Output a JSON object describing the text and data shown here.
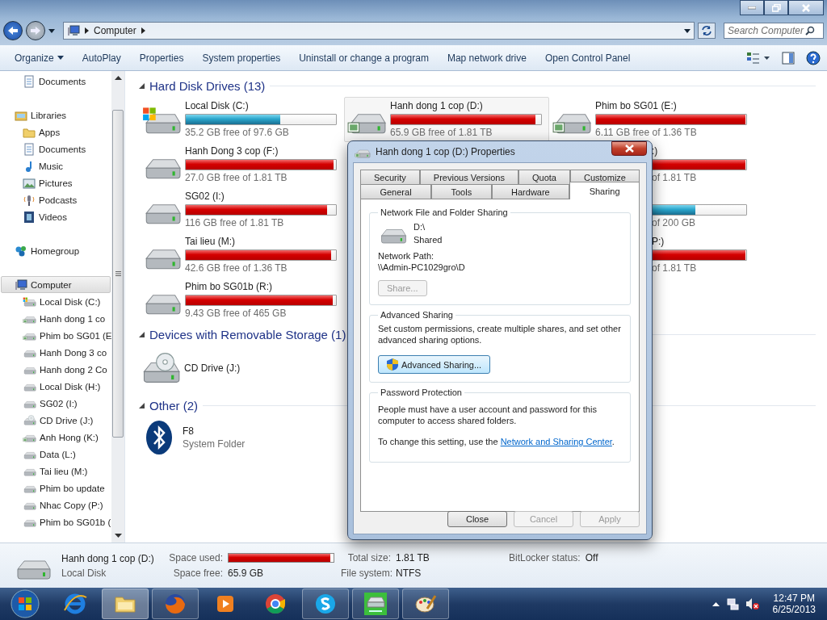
{
  "address_bar": {
    "breadcrumb": [
      "Computer"
    ],
    "search": {
      "placeholder": "Search Computer"
    }
  },
  "toolbar": {
    "items": [
      {
        "label": "Organize",
        "dropdown": true
      },
      {
        "label": "AutoPlay",
        "dropdown": false
      },
      {
        "label": "Properties",
        "dropdown": false
      },
      {
        "label": "System properties",
        "dropdown": false
      },
      {
        "label": "Uninstall or change a program",
        "dropdown": false
      },
      {
        "label": "Map network drive",
        "dropdown": false
      },
      {
        "label": "Open Control Panel",
        "dropdown": false
      }
    ]
  },
  "sidebar": {
    "scrolled_children": [
      {
        "label": "Documents",
        "kind": "document",
        "selected": false
      }
    ],
    "items": [
      {
        "label": "Libraries",
        "kind": "library",
        "selected": false,
        "children": [
          {
            "label": "Apps",
            "kind": "folder",
            "selected": false
          },
          {
            "label": "Documents",
            "kind": "document",
            "selected": false
          },
          {
            "label": "Music",
            "kind": "music",
            "selected": false
          },
          {
            "label": "Pictures",
            "kind": "pictures",
            "selected": false
          },
          {
            "label": "Podcasts",
            "kind": "podcast",
            "selected": false
          },
          {
            "label": "Videos",
            "kind": "video",
            "selected": false
          }
        ]
      },
      {
        "label": "Homegroup",
        "kind": "homegroup",
        "selected": false
      },
      {
        "label": "Computer",
        "kind": "computer",
        "selected": true,
        "children": [
          {
            "label": "Local Disk (C:)",
            "kind": "windows",
            "selected": false
          },
          {
            "label": "Hanh dong 1 co",
            "kind": "mapped",
            "selected": false
          },
          {
            "label": "Phim bo SG01 (E",
            "kind": "mapped",
            "selected": false
          },
          {
            "label": "Hanh Dong 3 co",
            "kind": "drive",
            "selected": false
          },
          {
            "label": "Hanh dong 2 Co",
            "kind": "drive",
            "selected": false
          },
          {
            "label": "Local Disk (H:)",
            "kind": "drive",
            "selected": false
          },
          {
            "label": "SG02 (I:)",
            "kind": "drive",
            "selected": false
          },
          {
            "label": "CD Drive (J:)",
            "kind": "cd",
            "selected": false
          },
          {
            "label": "Anh Hong (K:)",
            "kind": "mapped",
            "selected": false
          },
          {
            "label": "Data (L:)",
            "kind": "drive",
            "selected": false
          },
          {
            "label": "Tai lieu (M:)",
            "kind": "drive",
            "selected": false
          },
          {
            "label": "Phim bo update",
            "kind": "drive",
            "selected": false
          },
          {
            "label": "Nhac Copy (P:)",
            "kind": "drive",
            "selected": false
          },
          {
            "label": "Phim bo SG01b (",
            "kind": "drive",
            "selected": false
          }
        ]
      }
    ]
  },
  "sections": [
    {
      "title": "Hard Disk Drives (13)",
      "kind": "drives",
      "columns": [
        [
          {
            "kind": "windows",
            "label": "Local Disk (C:)",
            "level": 0.63,
            "free": "35.2 GB free of 97.6 GB",
            "selected": false
          },
          {
            "kind": "drive",
            "label": "Hanh Dong 3 cop (F:)",
            "level": 0.985,
            "free": "27.0 GB free of 1.81 TB",
            "selected": false
          },
          {
            "kind": "drive",
            "label": "SG02 (I:)",
            "level": 0.94,
            "free": "116 GB free of 1.81 TB",
            "selected": false
          },
          {
            "kind": "drive",
            "label": "Tai lieu (M:)",
            "level": 0.97,
            "free": "42.6 GB free of 1.36 TB",
            "selected": false
          },
          {
            "kind": "drive",
            "label": "Phim bo SG01b (R:)",
            "level": 0.98,
            "free": "9.43 GB free of 465 GB",
            "selected": false
          }
        ],
        [
          {
            "kind": "mapped",
            "label": "Hanh dong 1 cop (D:)",
            "level": 0.965,
            "free": "65.9 GB free of 1.81 TB",
            "selected": true
          }
        ],
        [
          {
            "kind": "mapped",
            "label": "Phim bo SG01 (E:)",
            "level": 0.995,
            "free": "6.11 GB free of 1.36 TB",
            "selected": false
          },
          {
            "kind": "clipped",
            "label": ":)",
            "level": 0.995,
            "free": "of 1.81 TB"
          },
          {
            "kind": "clipped",
            "level": 0.66,
            "free": "of 200 GB"
          },
          {
            "kind": "clipped",
            "label": "P:)",
            "level": 0.995,
            "free": "of 1.81 TB"
          }
        ]
      ]
    },
    {
      "title": "Devices with Removable Storage (1)",
      "kind": "devices",
      "items": [
        {
          "label": "CD Drive (J:)",
          "kind": "cd"
        }
      ]
    },
    {
      "title": "Other (2)",
      "kind": "other",
      "items": [
        {
          "label": "F8",
          "sublabel": "System Folder",
          "kind": "bluetooth"
        }
      ]
    }
  ],
  "details": {
    "name": "Hanh dong 1 cop (D:)",
    "type": "Local Disk",
    "fields": [
      {
        "label": "Space used:",
        "kind": "bar",
        "level": 0.97
      },
      {
        "label": "Total size:",
        "kind": "text",
        "value": "1.81 TB"
      },
      {
        "label": "BitLocker status:",
        "kind": "text",
        "value": "Off"
      },
      {
        "label": "Space free:",
        "kind": "text",
        "value": "65.9 GB"
      },
      {
        "label": "File system:",
        "kind": "text",
        "value": "NTFS"
      }
    ]
  },
  "dialog": {
    "title": "Hanh dong 1 cop (D:) Properties",
    "tab_rows": [
      [
        {
          "label": "Security",
          "selected": false
        },
        {
          "label": "Previous Versions",
          "selected": false
        },
        {
          "label": "Quota",
          "selected": false
        },
        {
          "label": "Customize",
          "selected": false
        }
      ],
      [
        {
          "label": "General",
          "selected": false
        },
        {
          "label": "Tools",
          "selected": false
        },
        {
          "label": "Hardware",
          "selected": false
        },
        {
          "label": "Sharing",
          "selected": true
        }
      ]
    ],
    "groups": [
      {
        "kind": "network-sharing",
        "title": "Network File and Folder Sharing",
        "path_name": "D:\\",
        "status": "Shared",
        "network_path_label": "Network Path:",
        "network_path": "\\\\Admin-PC1029gro\\D",
        "button": {
          "label": "Share...",
          "disabled": true,
          "shield": false
        }
      },
      {
        "kind": "advanced-sharing",
        "title": "Advanced Sharing",
        "description": "Set custom permissions, create multiple shares, and set other advanced sharing options.",
        "button": {
          "label": "Advanced Sharing...",
          "disabled": false,
          "shield": true
        }
      },
      {
        "kind": "password-protection",
        "title": "Password Protection",
        "description": "People must have a user account and password for this computer to access shared folders.",
        "note": "To change this setting, use the ",
        "link": "Network and Sharing Center",
        "note_end": "."
      }
    ],
    "buttons": [
      {
        "label": "Close",
        "disabled": false
      },
      {
        "label": "Cancel",
        "disabled": true
      },
      {
        "label": "Apply",
        "disabled": true
      }
    ]
  },
  "taskbar": {
    "apps": [
      {
        "kind": "browser-e",
        "running": false,
        "active": false
      },
      {
        "kind": "folder",
        "running": true,
        "active": true
      },
      {
        "kind": "fox",
        "running": true,
        "active": false
      },
      {
        "kind": "media",
        "running": false,
        "active": false
      },
      {
        "kind": "chrome",
        "running": false,
        "active": false
      },
      {
        "kind": "skype",
        "running": true,
        "active": false
      },
      {
        "kind": "copy",
        "running": true,
        "active": false
      },
      {
        "kind": "paint",
        "running": true,
        "active": false
      }
    ],
    "time": "12:47 PM",
    "date": "6/25/2013"
  }
}
